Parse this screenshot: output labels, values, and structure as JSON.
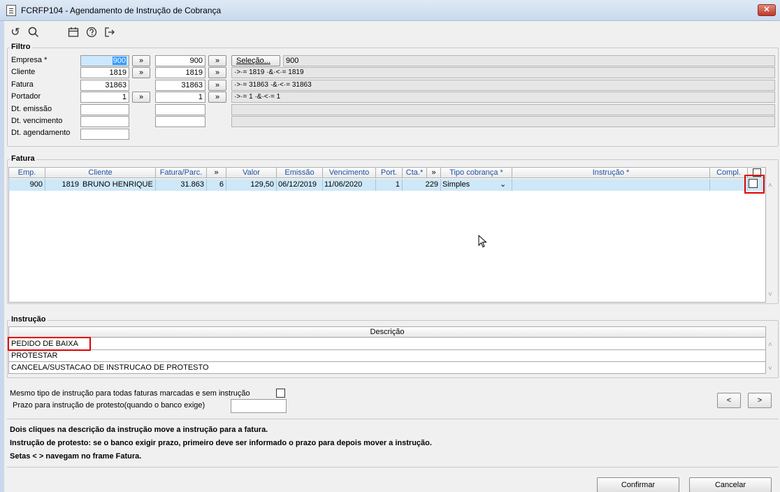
{
  "window": {
    "title": "FCRFP104 - Agendamento de Instrução de Cobrança",
    "close_glyph": "✕"
  },
  "toolbar": {
    "icons": [
      "undo-icon",
      "search-icon",
      "calendar-icon",
      "help-icon",
      "exit-icon"
    ]
  },
  "filtro": {
    "title": "Filtro",
    "rows": [
      {
        "label": "Empresa *",
        "from": "900",
        "to": "900",
        "desc": "900"
      },
      {
        "label": "Cliente",
        "from": "1819",
        "to": "1819",
        "desc": "·>·= 1819 ·&·<·= 1819"
      },
      {
        "label": "Fatura",
        "from": "31863",
        "to": "31863",
        "desc": "·>·= 31863 ·&·<·= 31863"
      },
      {
        "label": "Portador",
        "from": "1",
        "to": "1",
        "desc": "·>·= 1 ·&·<·= 1"
      },
      {
        "label": "Dt. emissão",
        "from": "",
        "to": "",
        "desc": ""
      },
      {
        "label": "Dt. vencimento",
        "from": "",
        "to": "",
        "desc": ""
      },
      {
        "label": "Dt. agendamento",
        "from": ""
      }
    ],
    "arrow_label": "»",
    "selecao_label": "Seleção..."
  },
  "fatura": {
    "title": "Fatura",
    "columns": [
      "Emp.",
      "Cliente",
      "Fatura/Parc.",
      "»",
      "Valor",
      "Emissão",
      "Vencimento",
      "Port.",
      "Cta.*",
      "»",
      "Tipo cobrança *",
      "Instrução *",
      "Compl."
    ],
    "row": {
      "emp": "900",
      "cliente_cod": "1819",
      "cliente_nome": "BRUNO HENRIQUE I",
      "fatura": "31.863",
      "parc": "6",
      "valor": "129,50",
      "emissao": "06/12/2019",
      "vencimento": "11/06/2020",
      "port": "1",
      "cta": "229",
      "tipo": "Simples",
      "instrucao": "",
      "compl": ""
    }
  },
  "instrucao": {
    "title": "Instrução",
    "column": "Descrição",
    "items": [
      "PEDIDO DE BAIXA",
      "PROTESTAR",
      "CANCELA/SUSTACAO DE INSTRUCAO DE PROTESTO"
    ]
  },
  "options": {
    "mesmo_tipo_label": "Mesmo tipo de instrução para todas faturas marcadas e sem instrução",
    "prazo_label": "Prazo para instrução de protesto(quando o banco exige)",
    "prazo_value": "",
    "prev_label": "<",
    "next_label": ">"
  },
  "notes": [
    "Dois cliques na descrição da instrução move a instrução para a fatura.",
    "Instrução de protesto: se o banco exigir prazo, primeiro deve ser informado o prazo para depois mover a instrução.",
    "Setas < > navegam no frame Fatura."
  ],
  "footer": {
    "confirm_label": "Confirmar",
    "cancel_label": "Cancelar"
  },
  "colors": {
    "selection": "#cfe8f8",
    "highlight_red": "#e00000",
    "header_text": "#1f4fa0"
  }
}
